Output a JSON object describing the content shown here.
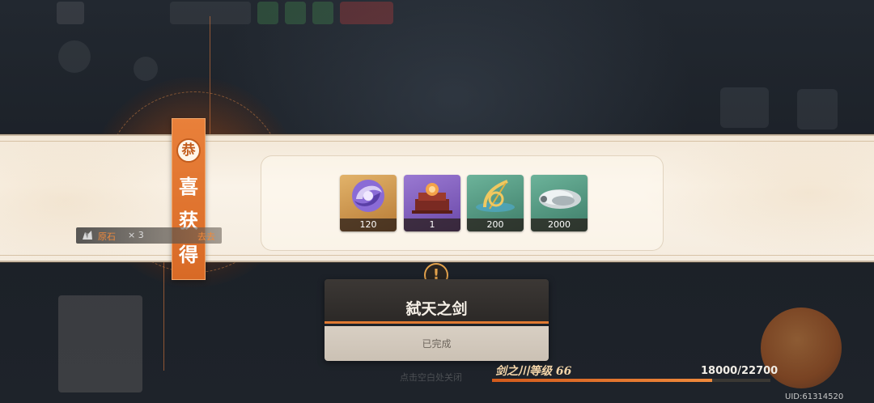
{
  "banner": {
    "ribbon_seal": "恭",
    "ribbon_chars": [
      "喜",
      "获",
      "得"
    ],
    "items": [
      {
        "name": "purple-orb-item",
        "quantity": "120",
        "rarity": "gold"
      },
      {
        "name": "treasure-chest-item",
        "quantity": "1",
        "rarity": "purple"
      },
      {
        "name": "golden-bow-item",
        "quantity": "200",
        "rarity": "green"
      },
      {
        "name": "silver-coins-item",
        "quantity": "2000",
        "rarity": "green"
      }
    ]
  },
  "loot_chip": {
    "name": "原石",
    "count": "× 3",
    "tail": "去去"
  },
  "mission": {
    "title": "弑天之剑",
    "status": "已完成"
  },
  "close_hint": "点击空白处关闭",
  "level": {
    "label": "剑之川等级",
    "value": "66",
    "exp_text": "18000/22700",
    "progress": 0.79
  },
  "uid": "UID:61314520",
  "colors": {
    "accent": "#e07a32",
    "banner_bg": "#faf3e8",
    "card_head": "#2c2927"
  }
}
